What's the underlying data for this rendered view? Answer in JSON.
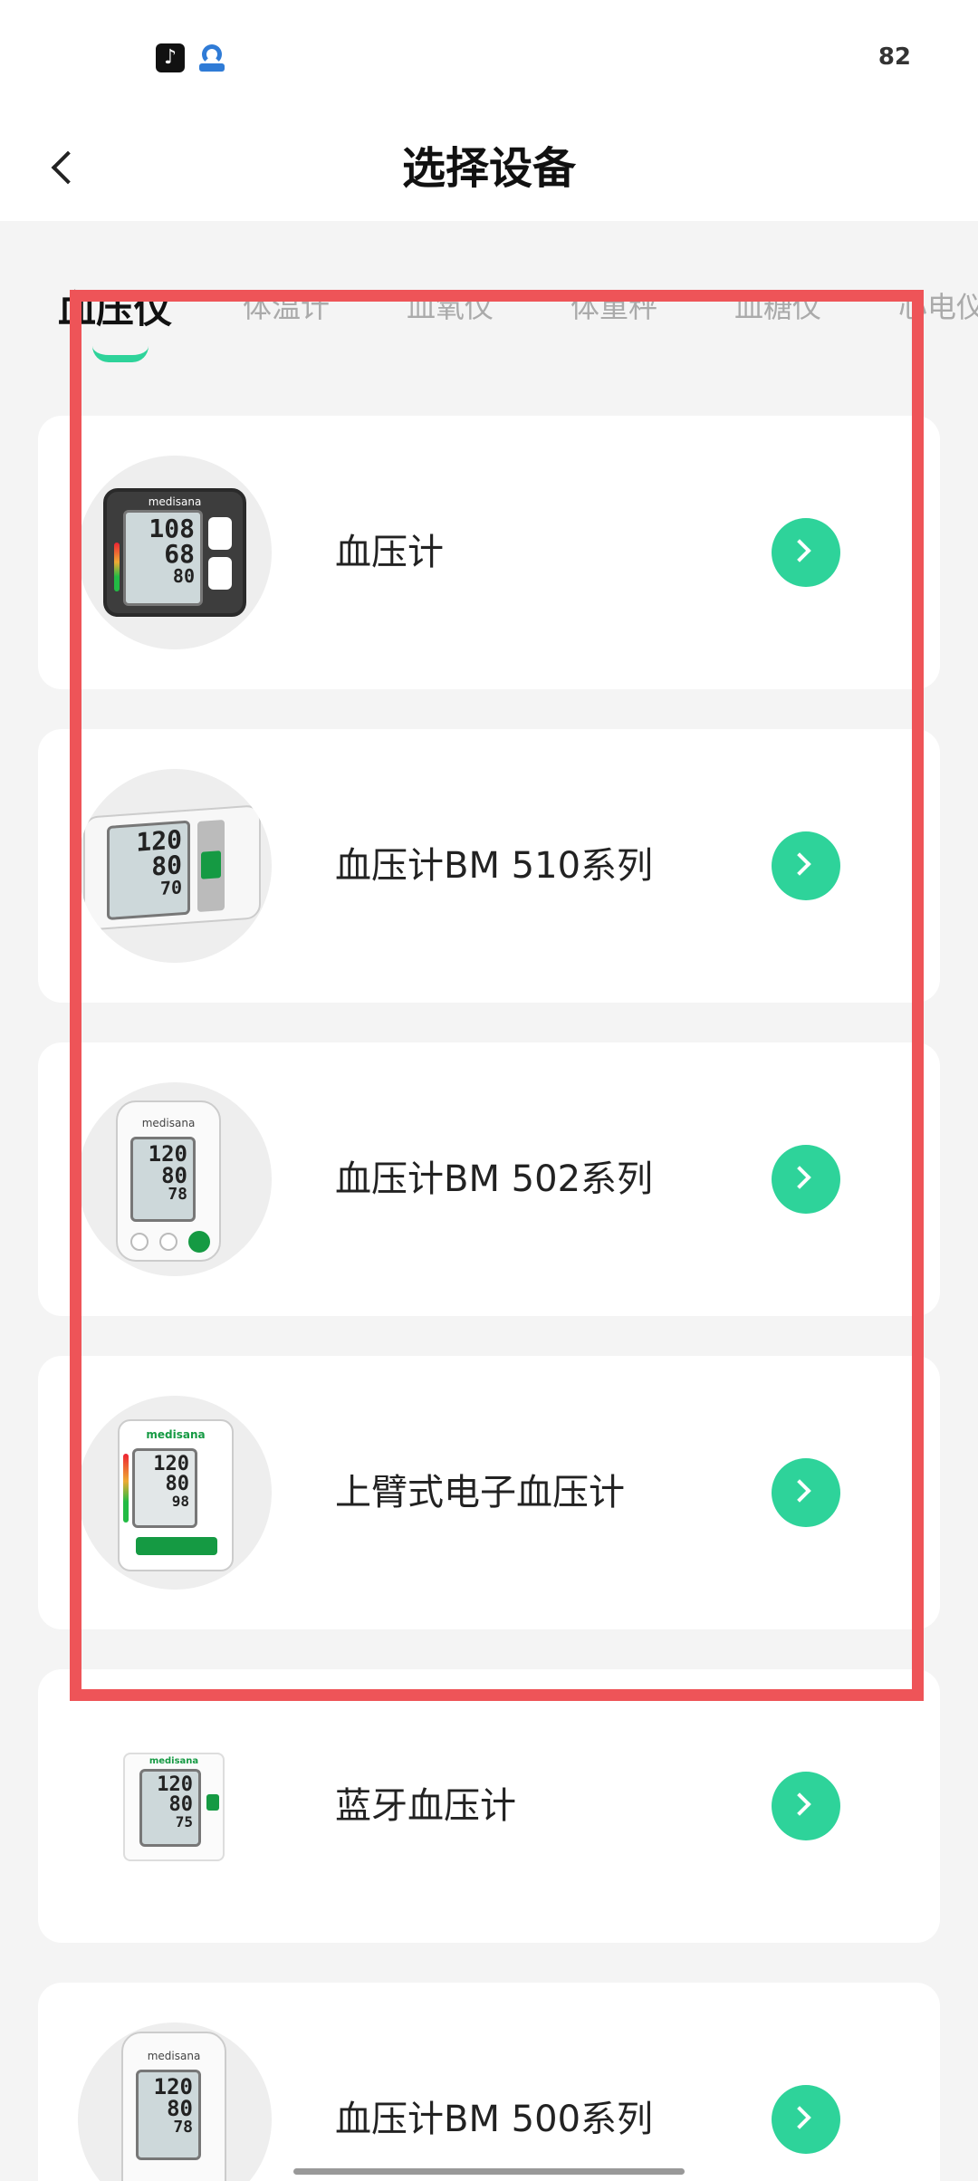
{
  "status_bar": {
    "battery": "82",
    "app_icons": [
      "tiktok-icon",
      "shield-app-icon"
    ]
  },
  "header": {
    "title": "选择设备",
    "back_icon": "chevron-left-icon"
  },
  "tabs": [
    {
      "label": "血压仪",
      "active": true
    },
    {
      "label": "体温计",
      "active": false
    },
    {
      "label": "血氧仪",
      "active": false
    },
    {
      "label": "体重秤",
      "active": false
    },
    {
      "label": "血糖仪",
      "active": false
    },
    {
      "label": "心电仪",
      "active": false
    }
  ],
  "devices": [
    {
      "name": "血压计",
      "lcd": [
        "108",
        "68",
        "80"
      ]
    },
    {
      "name": "血压计BM 510系列",
      "lcd": [
        "120",
        "80",
        "70"
      ]
    },
    {
      "name": "血压计BM 502系列",
      "lcd": [
        "120",
        "80",
        "78"
      ]
    },
    {
      "name": "上臂式电子血压计",
      "lcd": [
        "120",
        "80",
        "98"
      ]
    },
    {
      "name": "蓝牙血压计",
      "lcd": [
        "120",
        "80",
        "75"
      ]
    },
    {
      "name": "血压计BM 500系列",
      "lcd": [
        "120",
        "80",
        "78"
      ]
    }
  ],
  "brand": "medisana",
  "colors": {
    "accent": "#2ed39a",
    "highlight": "#ee5458",
    "background": "#f4f4f4"
  }
}
